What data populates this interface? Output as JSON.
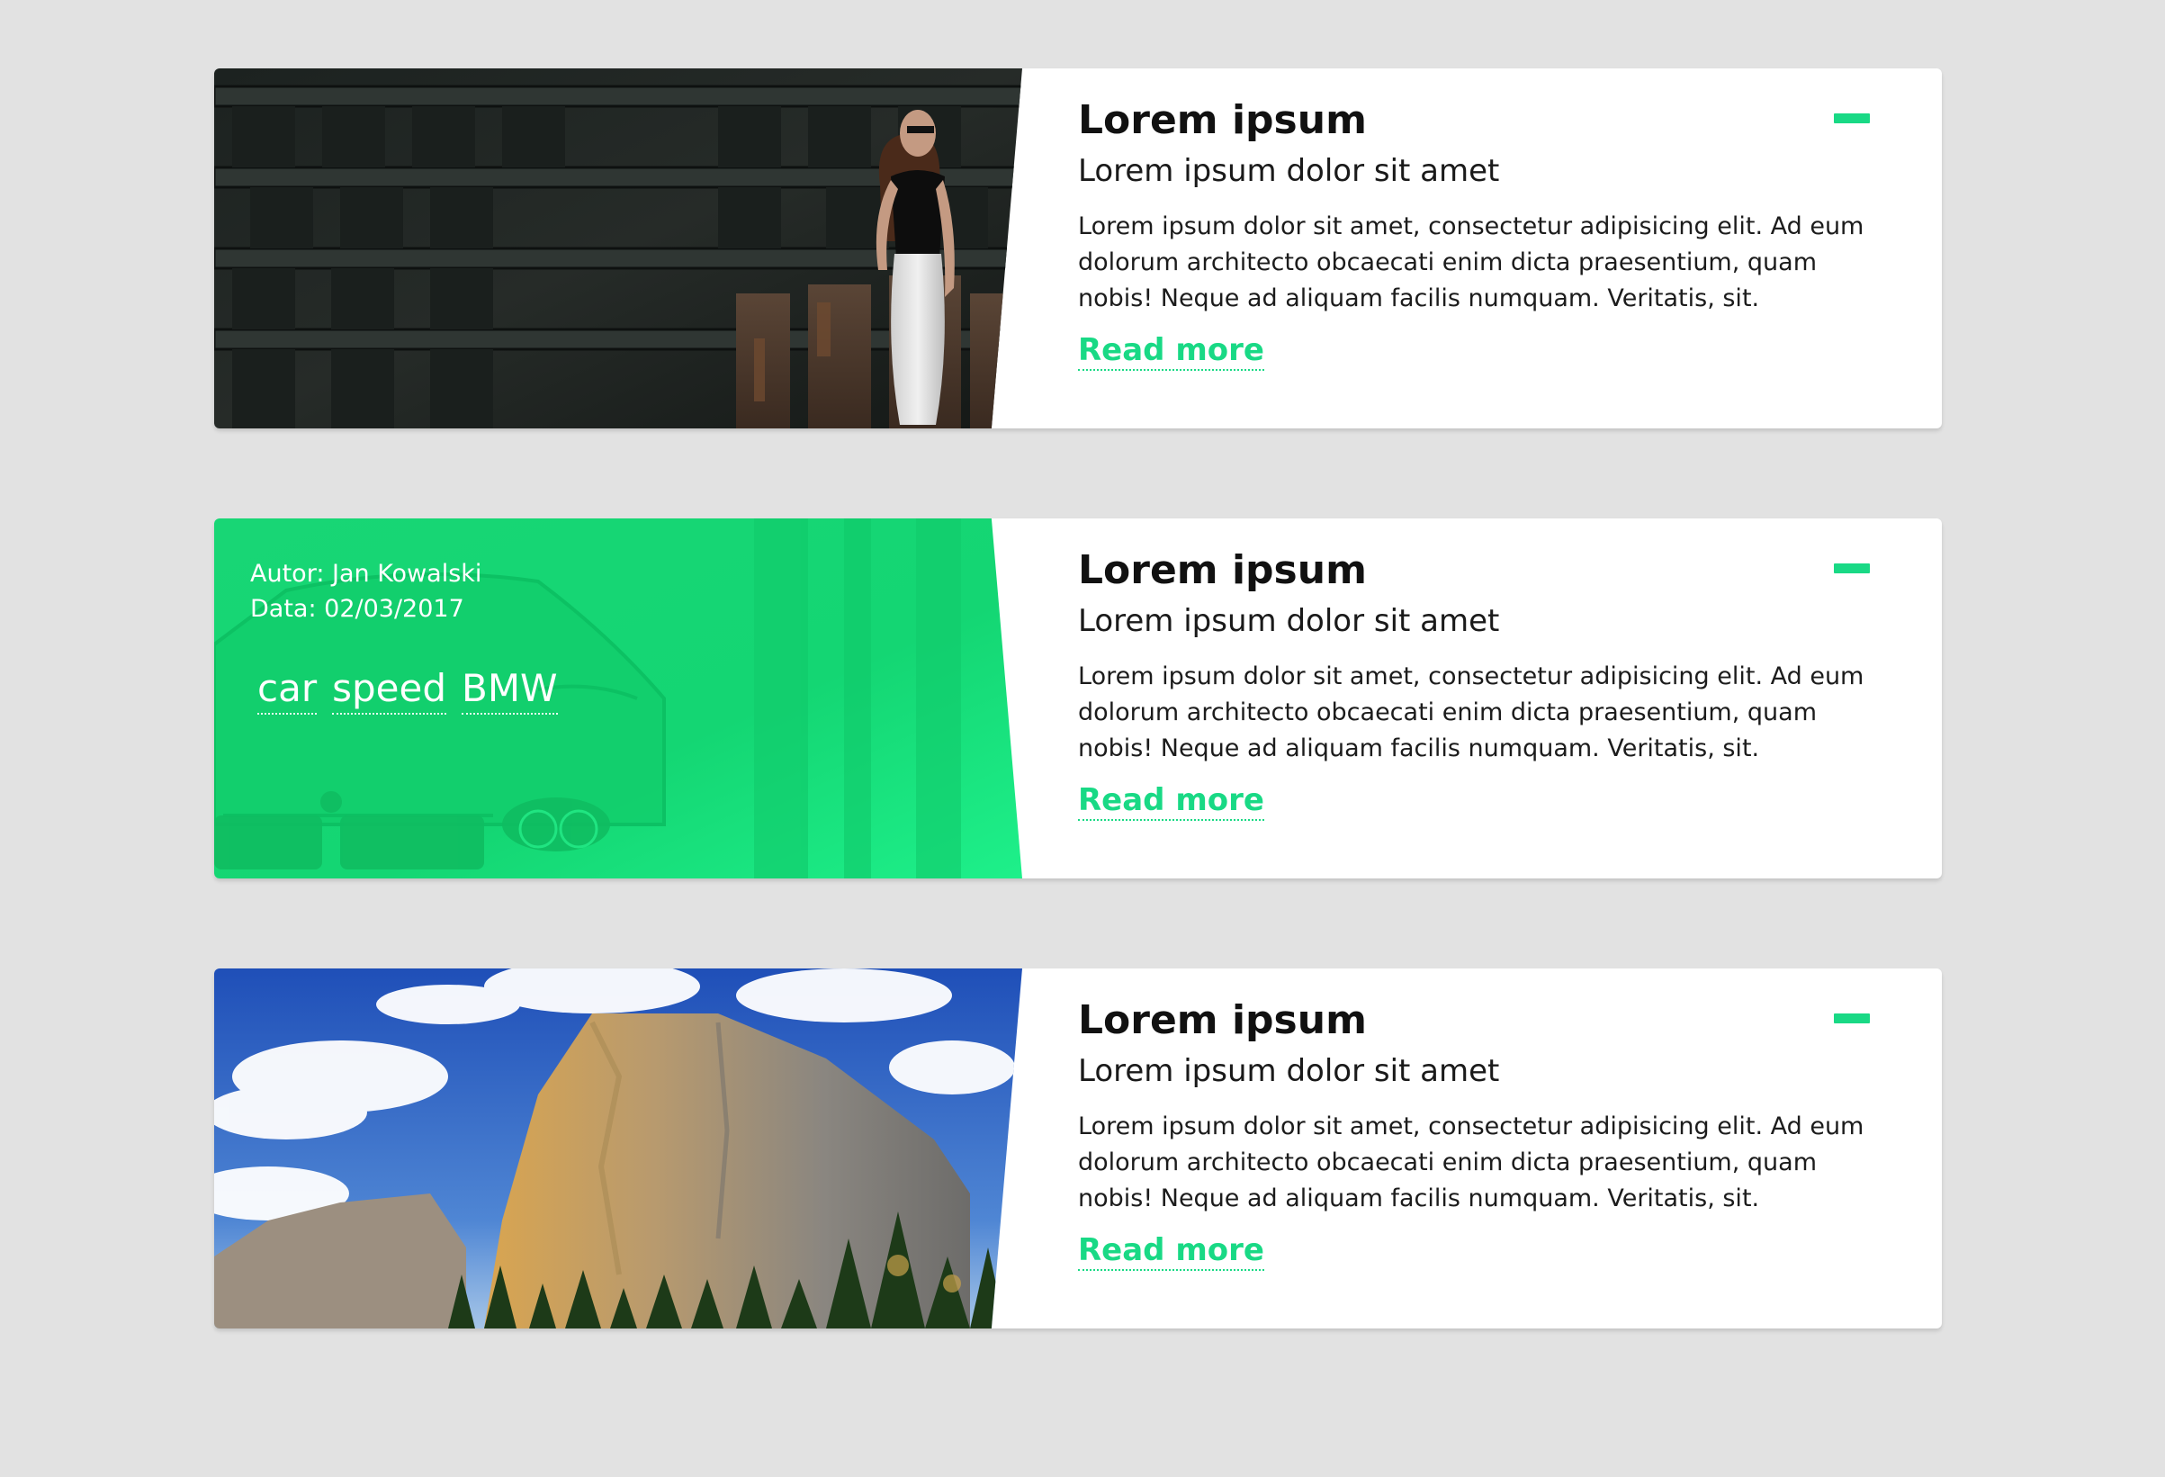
{
  "accent_color": "#19d985",
  "cards": [
    {
      "image": "woman-industrial-photo",
      "title": "Lorem ipsum",
      "subtitle": "Lorem ipsum dolor sit amet",
      "description": "Lorem ipsum dolor sit amet, consectetur adipisicing elit. Ad eum dolorum architecto obcaecati enim dicta praesentium, quam nobis! Neque ad aliquam facilis numquam. Veritatis, sit.",
      "read_more": "Read more",
      "toggle_icon": "minus-icon"
    },
    {
      "image": "car-photo-green-overlay",
      "author": "Autor: Jan Kowalski",
      "date": "Data: 02/03/2017",
      "tags": [
        "car",
        "speed",
        "BMW"
      ],
      "title": "Lorem ipsum",
      "subtitle": "Lorem ipsum dolor sit amet",
      "description": "Lorem ipsum dolor sit amet, consectetur adipisicing elit. Ad eum dolorum architecto obcaecati enim dicta praesentium, quam nobis! Neque ad aliquam facilis numquam. Veritatis, sit.",
      "read_more": "Read more",
      "toggle_icon": "minus-icon"
    },
    {
      "image": "mountain-landscape-photo",
      "title": "Lorem ipsum",
      "subtitle": "Lorem ipsum dolor sit amet",
      "description": "Lorem ipsum dolor sit amet, consectetur adipisicing elit. Ad eum dolorum architecto obcaecati enim dicta praesentium, quam nobis! Neque ad aliquam facilis numquam. Veritatis, sit.",
      "read_more": "Read more",
      "toggle_icon": "minus-icon"
    }
  ]
}
